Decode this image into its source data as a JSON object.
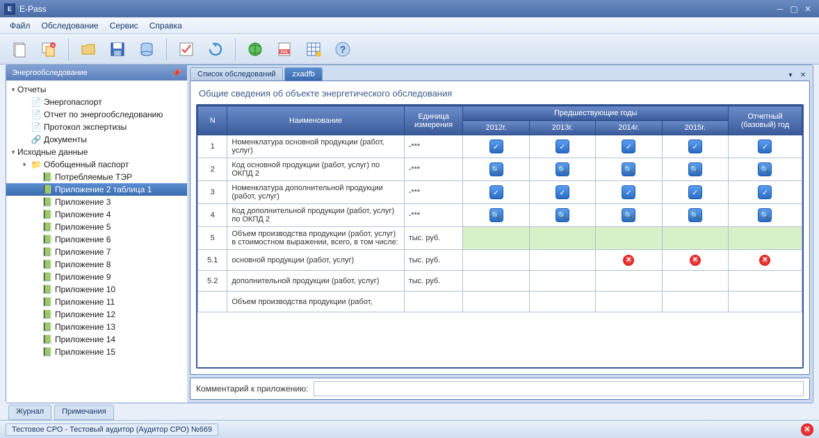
{
  "title": "E-Pass",
  "menu": [
    "Файл",
    "Обследование",
    "Сервис",
    "Справка"
  ],
  "sidebar": {
    "title": "Энергообследование",
    "nodes": {
      "reports": "Отчеты",
      "items1": [
        "Энергопаспорт",
        "Отчет по энергообследованию",
        "Протокол экспертизы",
        "Документы"
      ],
      "source": "Исходные данные",
      "passport": "Обобщенный паспорт",
      "items2": [
        "Потребляемые ТЭР",
        "Приложение 2 таблица 1",
        "Приложение 3",
        "Приложение 4",
        "Приложение 5",
        "Приложение 6",
        "Приложение 7",
        "Приложение 8",
        "Приложение 9",
        "Приложение 10",
        "Приложение 11",
        "Приложение 12",
        "Приложение 13",
        "Приложение 14",
        "Приложение 15"
      ]
    }
  },
  "tabs": [
    "Список обследований",
    "zxadfb"
  ],
  "content": {
    "title": "Общие сведения об объекте энергетического обследования",
    "headers": {
      "n": "N",
      "name": "Наименование",
      "unit": "Единица измерения",
      "prev": "Предшествующие годы",
      "years": [
        "2012г.",
        "2013г.",
        "2014г.",
        "2015г."
      ],
      "report": "Отчетный (базовый) год"
    },
    "rows": [
      {
        "n": "1",
        "name": "Номенклатура основной продукции (работ, услуг)",
        "unit": "-***",
        "type": "check"
      },
      {
        "n": "2",
        "name": "Код основной продукции (работ, услуг) по ОКПД 2",
        "unit": "-***",
        "type": "search"
      },
      {
        "n": "3",
        "name": "Номенклатура дополнительной продукции (работ, услуг)",
        "unit": "-***",
        "type": "check"
      },
      {
        "n": "4",
        "name": "Код дополнительной продукции (работ, услуг) по ОКПД 2",
        "unit": "-***",
        "type": "search"
      },
      {
        "n": "5",
        "name": "Объем производства продукции (работ, услуг) в стоимостном выражении, всего, в том числе:",
        "unit": "тыс. руб.",
        "type": "green"
      },
      {
        "n": "5.1",
        "name": "основной продукции (работ, услуг)",
        "unit": "тыс. руб.",
        "type": "err"
      },
      {
        "n": "5.2",
        "name": "дополнительной продукции (работ, услуг)",
        "unit": "тыс. руб.",
        "type": "blank"
      },
      {
        "n": "",
        "name": "Объем производства продукции (работ,",
        "unit": "",
        "type": "partial"
      }
    ],
    "comment_label": "Комментарий к приложению:",
    "comment_value": ""
  },
  "bottom_tabs": [
    "Журнал",
    "Примечания"
  ],
  "status": "Тестовое СРО - Тестовый аудитор (Аудитор СРО) №669"
}
